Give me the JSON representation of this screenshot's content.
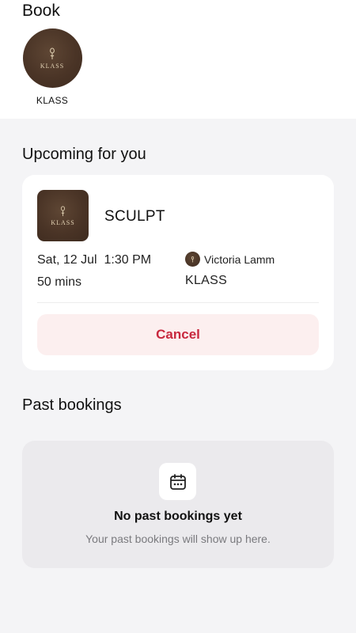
{
  "book_section": {
    "heading": "Book",
    "studio": {
      "logo_text": "KLASS",
      "name": "KLASS"
    }
  },
  "upcoming": {
    "title": "Upcoming for you",
    "booking": {
      "class_name": "SCULPT",
      "thumb_text": "KLASS",
      "datetime": "Sat, 12 Jul  1:30 PM",
      "duration": "50 mins",
      "instructor": "Victoria Lamm",
      "studio": "KLASS",
      "cancel_label": "Cancel"
    }
  },
  "past": {
    "title": "Past bookings",
    "empty_title": "No past bookings yet",
    "empty_subtitle": "Your past bookings will show up here.",
    "icon": "calendar-icon"
  },
  "colors": {
    "accent_red": "#c8283e",
    "cancel_bg": "#fcefef",
    "brand_brown": "#4a3426",
    "page_bg": "#f4f4f6"
  }
}
